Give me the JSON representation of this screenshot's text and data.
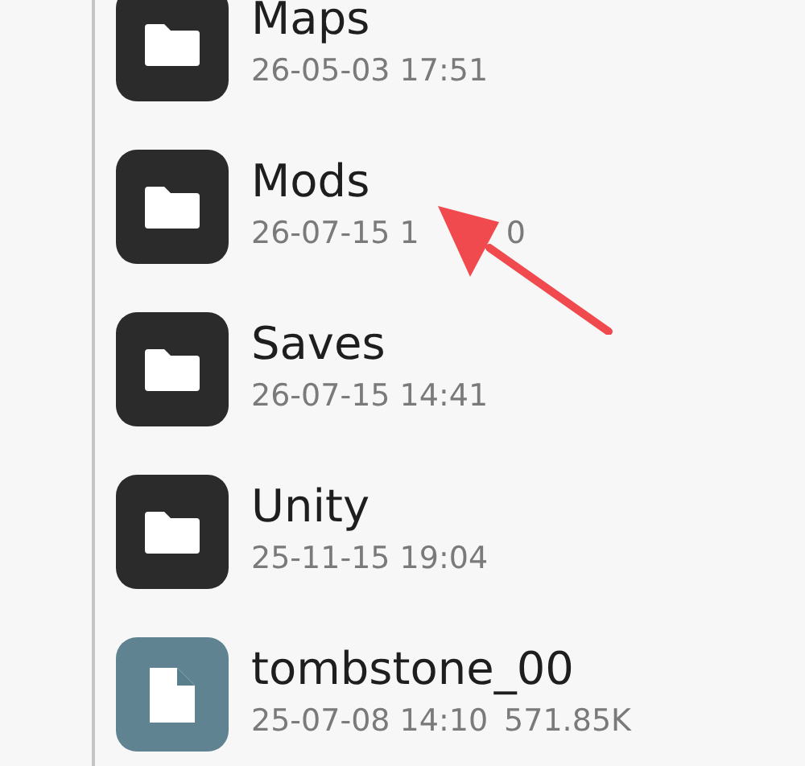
{
  "files": [
    {
      "kind": "folder",
      "name": "Maps",
      "date": "26-05-03 17:51"
    },
    {
      "kind": "folder",
      "name": "Mods",
      "date": "26-07-15 1",
      "date_after_arrow": "0"
    },
    {
      "kind": "folder",
      "name": "Saves",
      "date": "26-07-15 14:41"
    },
    {
      "kind": "folder",
      "name": "Unity",
      "date": "25-11-15 19:04"
    },
    {
      "kind": "file",
      "name": "tombstone_00",
      "date": "25-07-08 14:10",
      "size": "571.85K"
    }
  ]
}
